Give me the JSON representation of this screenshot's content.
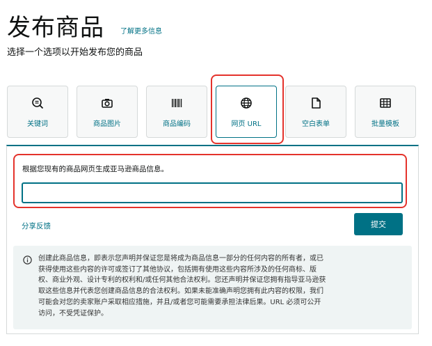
{
  "header": {
    "title": "发布商品",
    "learn_more": "了解更多信息",
    "subtitle": "选择一个选项以开始发布您的商品"
  },
  "tabs": [
    {
      "label": "关键词",
      "icon": "search-list-icon",
      "active": false
    },
    {
      "label": "商品图片",
      "icon": "camera-icon",
      "active": false
    },
    {
      "label": "商品编码",
      "icon": "barcode-icon",
      "active": false
    },
    {
      "label": "网页 URL",
      "icon": "globe-icon",
      "active": true
    },
    {
      "label": "空白表单",
      "icon": "document-icon",
      "active": false
    },
    {
      "label": "批量模板",
      "icon": "table-grid-icon",
      "active": false
    }
  ],
  "url_form": {
    "label": "根据您现有的商品网页生成亚马逊商品信息。",
    "input_value": "",
    "input_placeholder": "",
    "feedback_link": "分享反馈",
    "submit_label": "提交"
  },
  "notice": {
    "icon": "info-icon",
    "lines": [
      "创建此商品信息，即表示您声明并保证您是将成为商品信息一部分的任何内容的所有者，或已",
      "获得使用这些内容的许可或签订了其他协议，包括拥有使用这些内容所涉及的任何商标、版",
      "权、商业外观、设计专利的权利和/或任何其他合法权利。您还声明并保证您拥有指导亚马逊获",
      "取这些信息并代表您创建商品信息的合法权利。如果未能准确声明您拥有此内容的权限，我们",
      "可能会对您的卖家账户采取相应措施，并且/或者您可能需要承担法律后果。URL 必须可公开",
      "访问，不受凭证保护。"
    ]
  },
  "colors": {
    "accent": "#007185",
    "highlight": "#e4322b",
    "notice_bg": "#eff4f4"
  }
}
